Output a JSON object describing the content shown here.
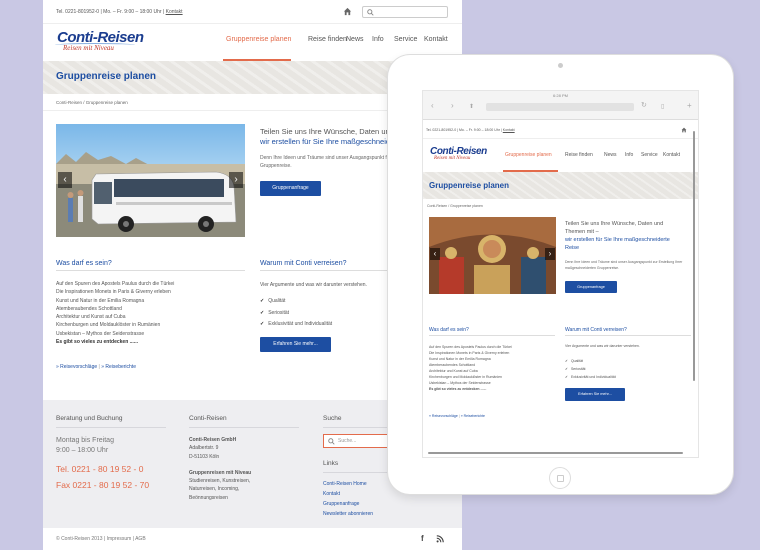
{
  "topbar": {
    "phone": "Tel. 0221-801952-0 | Mo. – Fr. 9:00 – 18:00 Uhr |",
    "kontakt": "Kontakt"
  },
  "logo": {
    "name": "Conti-Reisen",
    "tagline": "Reisen mit Niveau"
  },
  "nav": [
    "Gruppenreise planen",
    "Reise finden",
    "News",
    "Info",
    "Service",
    "Kontakt"
  ],
  "page": {
    "title": "Gruppenreise planen",
    "breadcrumb": "Conti-Reisen / Gruppenreise planen"
  },
  "intro": {
    "line1": "Teilen Sie uns Ihre Wünsche, Daten und",
    "line2": "wir erstellen für Sie Ihre maßgeschneiderte",
    "body": "Denn Ihre Ideen und Träume sind unser Ausgangspunkt für Ihre maßgeschneiderte Gruppenreise.",
    "button": "Gruppenanfrage"
  },
  "was": {
    "heading": "Was darf es sein?",
    "items": [
      "Auf den Spuren des Apostels Paulus durch die Türkei",
      "Die Inspirationen Monets in Paris & Giverny erleben",
      "Kunst und Natur in der Emilia Romagna",
      "Atemberaubendes Schottland",
      "Architektur und Kunst auf Cuba",
      "Kirchenburgen und Moldauklöster in Rumänien",
      "Usbekistan – Mythos der Seidenstrasse"
    ],
    "more": "Es gibt so vieles zu entdecken ......",
    "link1": "» Reisevorschläge",
    "sep": "|",
    "link2": "» Reiseberichte"
  },
  "warum": {
    "heading": "Warum mit Conti verreisen?",
    "intro": "Vier Argumente und was wir darunter verstehen.",
    "checks": [
      "Qualität",
      "Seriosität",
      "Exklusivität und Individualität"
    ],
    "button": "Erfahren Sie mehr..."
  },
  "footer": {
    "beratung": {
      "heading": "Beratung und Buchung",
      "hours1": "Montag bis Freitag",
      "hours2": "9:00 – 18:00 Uhr",
      "tel": "Tel. 0221 - 80 19 52 - 0",
      "fax": "Fax 0221 - 80 19 52 - 70"
    },
    "conti": {
      "heading": "Conti-Reisen",
      "company": "Conti-Reisen GmbH",
      "street": "Adalbertstr. 9",
      "city": "D-51103 Köln",
      "niveau": "Gruppenreisen mit Niveau",
      "services": [
        "Studienreisen, Kunstreisen,",
        "Naturreisen, Incoming,",
        "Beönnungsreisen"
      ]
    },
    "suche": {
      "heading": "Suche",
      "placeholder": "Suche..."
    },
    "links": {
      "heading": "Links",
      "items": [
        "Conti-Reisen Home",
        "Kontakt",
        "Gruppenanfrage",
        "Newsletter abonnieren"
      ]
    },
    "copyright": "© Conti-Reisen 2013 | Impressum | AGB"
  },
  "tablet": {
    "time": "6:28 PM",
    "intro1": "Teilen Sie uns Ihre Wünsche, Daten und",
    "intro1b": "Themen mit –",
    "intro2": "wir erstellen für Sie Ihre maßgeschneiderte",
    "intro2b": "Reise",
    "body": "Denn Ihre Ideen und Träume sind unser Ausgangspunkt zur Erstellung Ihrer maßgeschneiderten Gruppenreise."
  },
  "colors": {
    "brand": "#1d4ea2",
    "accent": "#e36b4b",
    "background": "#c9c8e4"
  }
}
